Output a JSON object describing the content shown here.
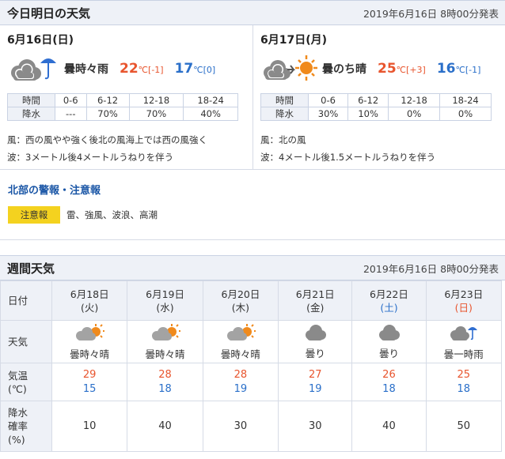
{
  "today": {
    "title": "今日明日の天気",
    "issued": "2019年6月16日 8時00分発表",
    "days": [
      {
        "date": "6月16日(日)",
        "weather": "曇時々雨",
        "icon": "cloud-umbrella-icon",
        "high": "22",
        "high_unit": "℃[-1]",
        "low": "17",
        "low_unit": "℃[0]",
        "rain_header": [
          "時間",
          "0-6",
          "6-12",
          "12-18",
          "18-24"
        ],
        "rain_values": [
          "降水",
          "---",
          "70%",
          "70%",
          "40%"
        ],
        "wind": "風：西の風やや強く後北の風海上では西の風強く",
        "wave": "波：3メートル後4メートルうねりを伴う"
      },
      {
        "date": "6月17日(月)",
        "weather": "曇のち晴",
        "icon": "cloud-then-sun-icon",
        "high": "25",
        "high_unit": "℃[+3]",
        "low": "16",
        "low_unit": "℃[-1]",
        "rain_header": [
          "時間",
          "0-6",
          "6-12",
          "12-18",
          "18-24"
        ],
        "rain_values": [
          "降水",
          "30%",
          "10%",
          "0%",
          "0%"
        ],
        "wind": "風：北の風",
        "wave": "波：4メートル後1.5メートルうねりを伴う"
      }
    ]
  },
  "warnings": {
    "title": "北部の警報・注意報",
    "badge": "注意報",
    "text": "雷、強風、波浪、高潮"
  },
  "weekly": {
    "title": "週間天気",
    "issued": "2019年6月16日 8時00分発表",
    "row_labels": {
      "date": "日付",
      "weather": "天気",
      "temp_line1": "気温",
      "temp_line2": "(℃)",
      "rain_line1": "降水",
      "rain_line2": "確率",
      "rain_line3": "(%)"
    },
    "days": [
      {
        "date": "6月18日",
        "dow": "(火)",
        "dow_type": "weekday",
        "weather": "曇時々晴",
        "icon": "cloud-sun-icon",
        "high": "29",
        "low": "15",
        "rain": "10"
      },
      {
        "date": "6月19日",
        "dow": "(水)",
        "dow_type": "weekday",
        "weather": "曇時々晴",
        "icon": "cloud-sun-icon",
        "high": "28",
        "low": "18",
        "rain": "40"
      },
      {
        "date": "6月20日",
        "dow": "(木)",
        "dow_type": "weekday",
        "weather": "曇時々晴",
        "icon": "cloud-sun-icon",
        "high": "28",
        "low": "19",
        "rain": "30"
      },
      {
        "date": "6月21日",
        "dow": "(金)",
        "dow_type": "weekday",
        "weather": "曇り",
        "icon": "cloud-icon",
        "high": "27",
        "low": "19",
        "rain": "30"
      },
      {
        "date": "6月22日",
        "dow": "(土)",
        "dow_type": "sat",
        "weather": "曇り",
        "icon": "cloud-icon",
        "high": "26",
        "low": "18",
        "rain": "40"
      },
      {
        "date": "6月23日",
        "dow": "(日)",
        "dow_type": "sun",
        "weather": "曇一時雨",
        "icon": "cloud-umbrella-icon",
        "high": "25",
        "low": "18",
        "rain": "50"
      }
    ]
  },
  "colors": {
    "high": "#e8552e",
    "low": "#2a6fc9",
    "header_bg": "#eef1f7",
    "badge": "#f4d21f",
    "link": "#1a56a6"
  }
}
